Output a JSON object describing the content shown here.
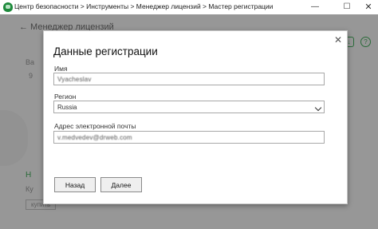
{
  "titlebar": {
    "breadcrumb": "Центр безопасности > Инструменты > Менеджер лицензий > Мастер регистрации",
    "minimize_icon": "minimize-icon",
    "maximize_icon": "maximize-icon",
    "close_icon": "close-icon"
  },
  "background": {
    "header": "← Менеджер лицензий",
    "left_fragments": [
      "Ва",
      "9",
      "Н",
      "Ку",
      "купить"
    ]
  },
  "dialog": {
    "title": "Данные регистрации",
    "name_label": "Имя",
    "name_value": "Vyacheslav",
    "region_label": "Регион",
    "region_value": "Russia",
    "email_label": "Адрес электронной почты",
    "email_value": "v.medvedev@drweb.com",
    "back_button": "Назад",
    "next_button": "Далее",
    "close_glyph": "✕"
  },
  "colors": {
    "brand_green": "#1e8a3c",
    "overlay": "#282828"
  }
}
